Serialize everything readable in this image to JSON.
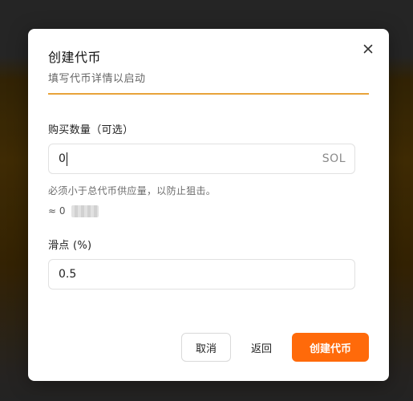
{
  "dialog": {
    "title": "创建代币",
    "subtitle": "填写代币详情以启动",
    "close_icon": "close-icon"
  },
  "buy_amount": {
    "label": "购买数量（可选）",
    "value": "0",
    "unit": "SOL",
    "hint": "必须小于总代币供应量，以防止狙击。",
    "approx": "≈ 0"
  },
  "slippage": {
    "label": "滑点 (%)",
    "value": "0.5"
  },
  "actions": {
    "cancel_label": "取消",
    "back_label": "返回",
    "create_label": "创建代币"
  },
  "colors": {
    "accent": "#ff6a0a",
    "divider": "#e8a33a"
  }
}
